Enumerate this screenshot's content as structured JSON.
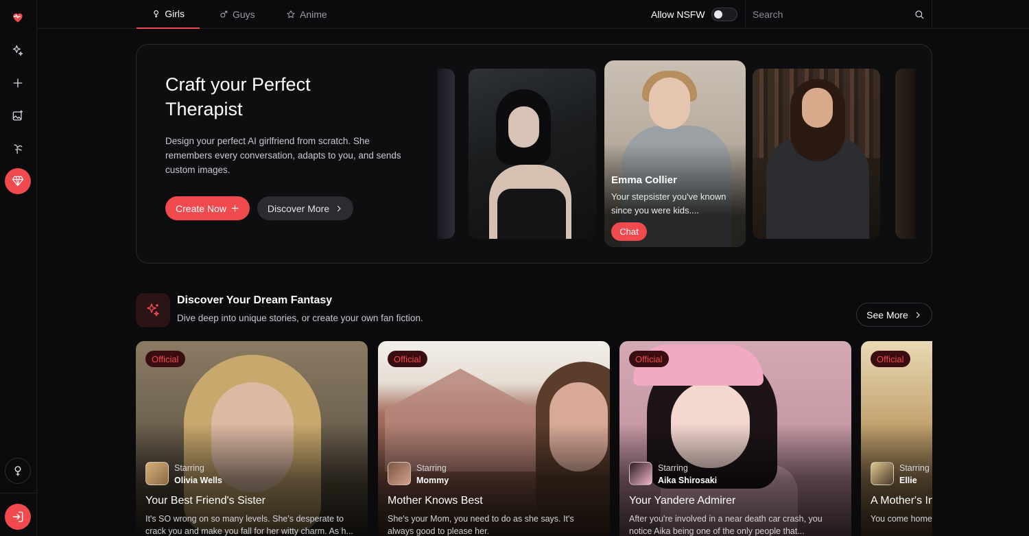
{
  "colors": {
    "accent": "#f04a4f",
    "background": "#0b0b0d"
  },
  "sidebar": {
    "items": [
      {
        "icon": "heart-pulse-icon"
      },
      {
        "icon": "sparkles-icon"
      },
      {
        "icon": "plus-icon"
      },
      {
        "icon": "image-plus-icon"
      },
      {
        "icon": "hanger-icon"
      },
      {
        "icon": "diamond-icon"
      }
    ],
    "bottom": [
      {
        "icon": "gender-icon"
      },
      {
        "icon": "login-icon"
      }
    ]
  },
  "topbar": {
    "tabs": [
      {
        "label": "Girls",
        "icon": "female-icon",
        "active": true
      },
      {
        "label": "Guys",
        "icon": "male-icon",
        "active": false
      },
      {
        "label": "Anime",
        "icon": "star-icon",
        "active": false
      }
    ],
    "nsfw_label": "Allow NSFW",
    "nsfw_enabled": false,
    "search_placeholder": "Search"
  },
  "hero": {
    "title": "Craft your Perfect Therapist",
    "description": "Design your perfect AI girlfriend from scratch. She remembers every conversation, adapts to you, and sends custom images.",
    "create_label": "Create Now",
    "discover_label": "Discover More",
    "featured": {
      "name": "Emma Collier",
      "description": "Your stepsister you've known since you were kids....",
      "chat_label": "Chat"
    }
  },
  "section": {
    "title": "Discover Your Dream Fantasy",
    "subtitle": "Dive deep into unique stories, or create your own fan fiction.",
    "see_more_label": "See More"
  },
  "stories": [
    {
      "badge": "Official",
      "starring_label": "Starring",
      "star": "Olivia Wells",
      "title": "Your Best Friend's Sister",
      "description": "It's SO wrong on so many levels. She's desperate to crack you and make you fall for her witty charm. As h..."
    },
    {
      "badge": "Official",
      "starring_label": "Starring",
      "star": "Mommy",
      "title": "Mother Knows Best",
      "description": "She's your Mom, you need to do as she says. It's always good to please her."
    },
    {
      "badge": "Official",
      "starring_label": "Starring",
      "star": "Aika Shirosaki",
      "title": "Your Yandere Admirer",
      "description": "After you're involved in a near death car crash, you notice Aika being one of the only people that..."
    },
    {
      "badge": "Official",
      "starring_label": "Starring",
      "star": "Ellie",
      "title": "A Mother's In",
      "description": "You come home chaos of the day"
    }
  ]
}
